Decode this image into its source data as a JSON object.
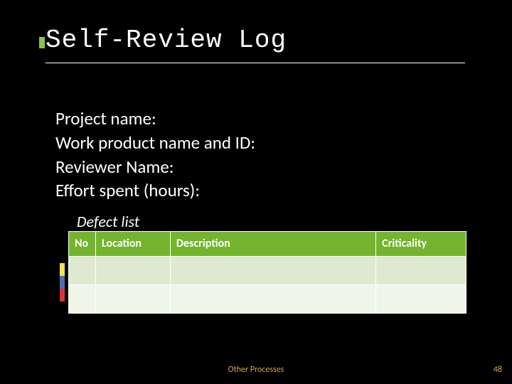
{
  "title": "Self-Review Log",
  "fields": {
    "project_name": "Project name:",
    "work_product": "Work product name and ID:",
    "reviewer": "Reviewer Name:",
    "effort": "Effort spent (hours):"
  },
  "defect_list_heading": "Defect list",
  "table": {
    "headers": {
      "no": "No",
      "location": "Location",
      "description": "Description",
      "criticality": "Criticality"
    },
    "rows": [
      {
        "no": "",
        "location": "",
        "description": "",
        "criticality": ""
      },
      {
        "no": "",
        "location": "",
        "description": "",
        "criticality": ""
      }
    ]
  },
  "footer": {
    "center": "Other Processes",
    "page": "48"
  },
  "colors": {
    "accent_green": "#74b42e",
    "row_alt1": "#deead0",
    "row_alt2": "#f0f5e9",
    "footer_text": "#d8a54a"
  }
}
